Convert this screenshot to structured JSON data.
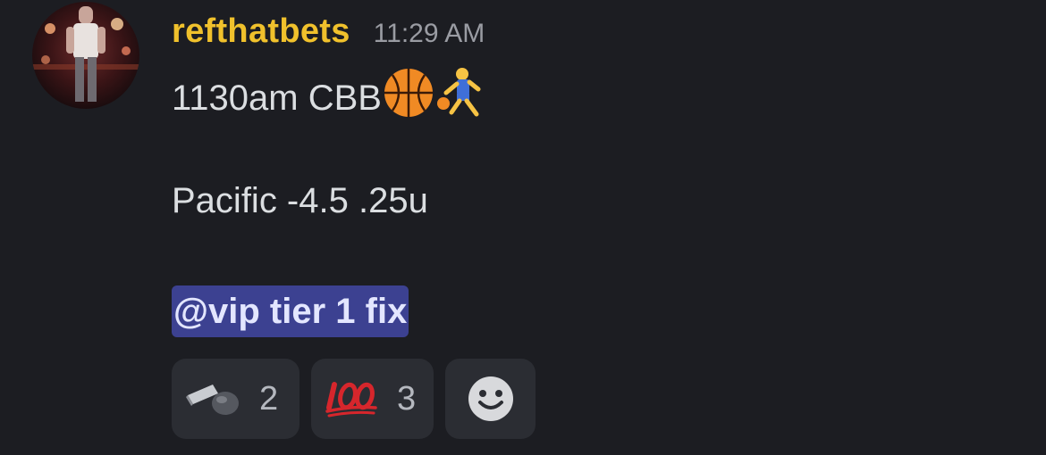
{
  "message": {
    "username": "refthatbets",
    "timestamp": "11:29 AM",
    "line1_text": "1130am CBB",
    "line1_emojis": [
      "basketball-icon",
      "person-bouncing-ball-icon"
    ],
    "line2_text": "Pacific -4.5 .25u",
    "mention": "@vip tier 1 fix"
  },
  "reactions": [
    {
      "icon": "whistle-icon",
      "count": "2"
    },
    {
      "icon": "hundred-points-icon",
      "count": "3"
    }
  ],
  "add_reaction": {
    "icon": "smiley-icon"
  },
  "colors": {
    "background": "#1c1d22",
    "username": "#f0c12c",
    "mention_bg": "#3c4191",
    "reaction_bg": "#2b2d33"
  }
}
